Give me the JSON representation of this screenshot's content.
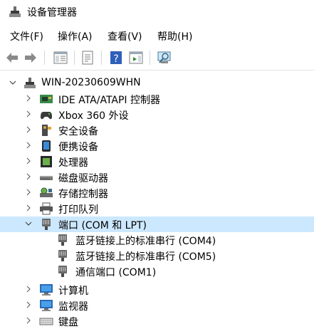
{
  "window": {
    "title": "设备管理器"
  },
  "menu": [
    {
      "label": "文件(F)"
    },
    {
      "label": "操作(A)"
    },
    {
      "label": "查看(V)"
    },
    {
      "label": "帮助(H)"
    }
  ],
  "toolbar": [
    {
      "icon": "back-arrow-icon"
    },
    {
      "icon": "forward-arrow-icon"
    },
    {
      "icon": "show-hide-console-tree-icon"
    },
    {
      "icon": "properties-icon"
    },
    {
      "icon": "help-icon"
    },
    {
      "icon": "action-pane-icon"
    },
    {
      "icon": "scan-hardware-icon"
    }
  ],
  "tree": {
    "root": {
      "label": "WIN-20230609WHN",
      "expanded": true,
      "icon": "computer-icon"
    },
    "categories": [
      {
        "label": "IDE ATA/ATAPI 控制器",
        "icon": "ide-controller-icon",
        "expanded": false
      },
      {
        "label": "Xbox 360 外设",
        "icon": "gamepad-icon",
        "expanded": false
      },
      {
        "label": "安全设备",
        "icon": "security-key-icon",
        "expanded": false
      },
      {
        "label": "便携设备",
        "icon": "portable-device-icon",
        "expanded": false
      },
      {
        "label": "处理器",
        "icon": "processor-icon",
        "expanded": false
      },
      {
        "label": "磁盘驱动器",
        "icon": "disk-drive-icon",
        "expanded": false
      },
      {
        "label": "存储控制器",
        "icon": "storage-controller-icon",
        "expanded": false
      },
      {
        "label": "打印队列",
        "icon": "printer-icon",
        "expanded": false
      },
      {
        "label": "端口 (COM 和 LPT)",
        "icon": "port-icon",
        "expanded": true,
        "selected": true,
        "children": [
          {
            "label": "蓝牙链接上的标准串行 (COM4)",
            "icon": "port-icon"
          },
          {
            "label": "蓝牙链接上的标准串行 (COM5)",
            "icon": "port-icon"
          },
          {
            "label": "通信端口 (COM1)",
            "icon": "port-icon"
          }
        ]
      },
      {
        "label": "计算机",
        "icon": "monitor-icon",
        "expanded": false
      },
      {
        "label": "监视器",
        "icon": "monitor-icon",
        "expanded": false
      },
      {
        "label": "键盘",
        "icon": "keyboard-icon",
        "expanded": false
      }
    ]
  },
  "colors": {
    "selection": "#cce8ff",
    "accent": "#1e6fd9"
  }
}
